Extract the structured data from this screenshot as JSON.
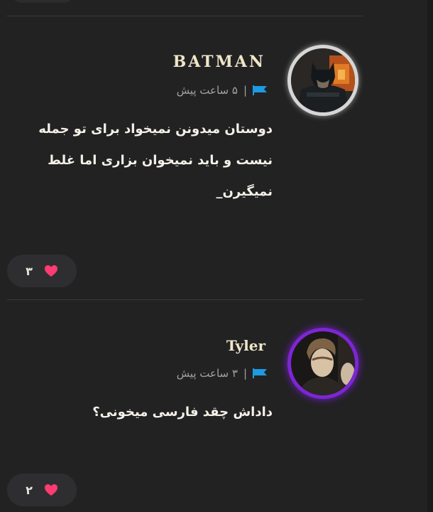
{
  "comments": [
    {
      "username": "BATMAN",
      "separator": "|",
      "time": "۵ ساعت پیش",
      "text": "دوستان میدونن نمیخواد برای تو جمله نیست و باید نمیخوان بزاری اما غلط نمیگیرن_",
      "likes": "۳",
      "flag_icon": "flag-icon",
      "like_icon": "heart-icon",
      "accent_color": "#1e9be0",
      "avatar_ring_color": "#d9d9d9",
      "heart_color": "#ff3b73"
    },
    {
      "username": "Tyler",
      "separator": "|",
      "time": "۳ ساعت پیش",
      "text": "داداش چقد فارسی میخونی؟",
      "likes": "۲",
      "flag_icon": "flag-icon",
      "like_icon": "heart-icon",
      "accent_color": "#1e9be0",
      "avatar_ring_color": "#8b2ce0",
      "heart_color": "#ff3b73"
    }
  ]
}
